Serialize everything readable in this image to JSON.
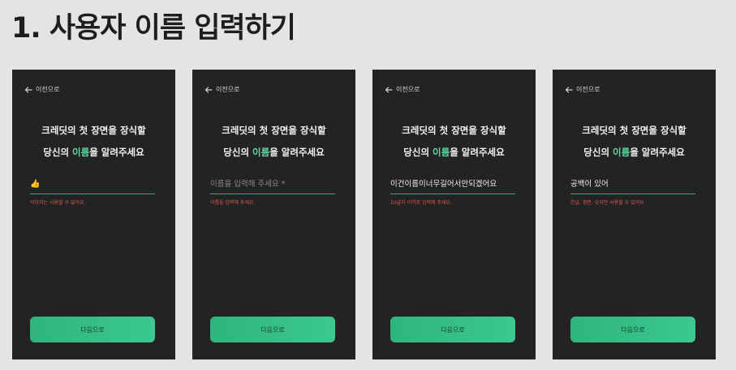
{
  "title": "1. 사용자 이름 입력하기",
  "colors": {
    "background": "#e4e4e4",
    "screen": "#232323",
    "accent": "#2bb27b",
    "highlight": "#5fd6a0",
    "error": "#e2584f"
  },
  "screens": [
    {
      "back_label": "이전으로",
      "heading_line1": "크레딧의 첫 장면을 장식할",
      "heading_pre": "당신의 ",
      "heading_hl": "이름",
      "heading_post": "을 알려주세요",
      "input_value": "👍",
      "input_placeholder": "",
      "error_text": "이모지는 사용할 수 없어요.",
      "next_label": "다음으로"
    },
    {
      "back_label": "이전으로",
      "heading_line1": "크레딧의 첫 장면을 장식할",
      "heading_pre": "당신의 ",
      "heading_hl": "이름",
      "heading_post": "을 알려주세요",
      "input_value": "",
      "input_placeholder": "이름을 입력해 주세요 *",
      "error_text": "이름을 입력해 주세요.",
      "next_label": "다음으로"
    },
    {
      "back_label": "이전으로",
      "heading_line1": "크레딧의 첫 장면을 장식할",
      "heading_pre": "당신의 ",
      "heading_hl": "이름",
      "heading_post": "을 알려주세요",
      "input_value": "이건이름이너무길어서안되겠어요",
      "input_placeholder": "",
      "error_text": "10글자 이하로 입력해 주세요.",
      "next_label": "다음으로"
    },
    {
      "back_label": "이전으로",
      "heading_line1": "크레딧의 첫 장면을 장식할",
      "heading_pre": "당신의 ",
      "heading_hl": "이름",
      "heading_post": "을 알려주세요",
      "input_value": "공백이 있어",
      "input_placeholder": "",
      "error_text": "한글, 영문, 숫자만 사용할 수 있어요",
      "next_label": "다음으로"
    }
  ]
}
